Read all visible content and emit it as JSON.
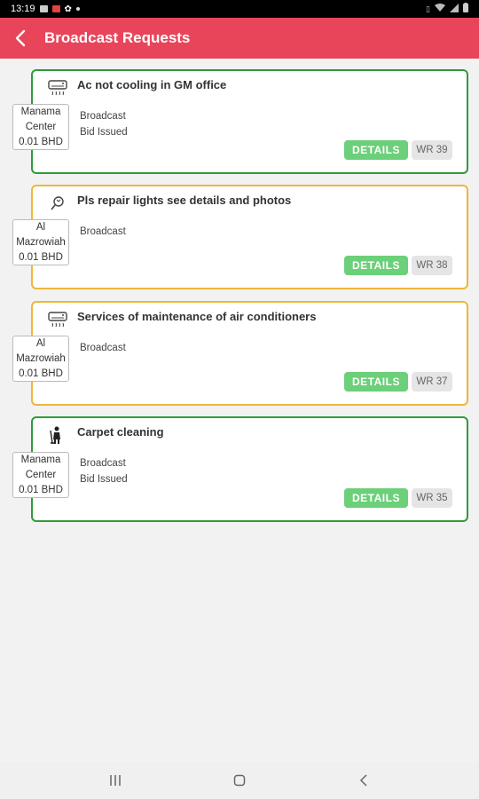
{
  "status_bar": {
    "time": "13:19"
  },
  "app_bar": {
    "title": "Broadcast Requests"
  },
  "requests": [
    {
      "title": "Ac not cooling in GM office",
      "icon": "air-conditioner-icon",
      "status_lines": [
        "Broadcast",
        "Bid Issued"
      ],
      "location": [
        "Manama",
        "Center"
      ],
      "price": "0.01 BHD",
      "details_label": "DETAILS",
      "wr": "WR 39",
      "border_color": "#2e9b3a"
    },
    {
      "title": "Pls repair lights see details and photos",
      "icon": "light-bulb-icon",
      "status_lines": [
        "Broadcast"
      ],
      "location": [
        "Al",
        "Mazrowiah"
      ],
      "price": "0.01 BHD",
      "details_label": "DETAILS",
      "wr": "WR 38",
      "border_color": "#f0b63a"
    },
    {
      "title": "Services of maintenance of air conditioners",
      "icon": "air-conditioner-icon",
      "status_lines": [
        "Broadcast"
      ],
      "location": [
        "Al",
        "Mazrowiah"
      ],
      "price": "0.01 BHD",
      "details_label": "DETAILS",
      "wr": "WR 37",
      "border_color": "#f0b63a"
    },
    {
      "title": "Carpet cleaning",
      "icon": "cleaning-person-icon",
      "status_lines": [
        "Broadcast",
        "Bid Issued"
      ],
      "location": [
        "Manama",
        "Center"
      ],
      "price": "0.01 BHD",
      "details_label": "DETAILS",
      "wr": "WR 35",
      "border_color": "#2e9b3a"
    }
  ],
  "nav_bar": {
    "recents": "recents-icon",
    "home": "home-icon",
    "back": "back-icon"
  }
}
